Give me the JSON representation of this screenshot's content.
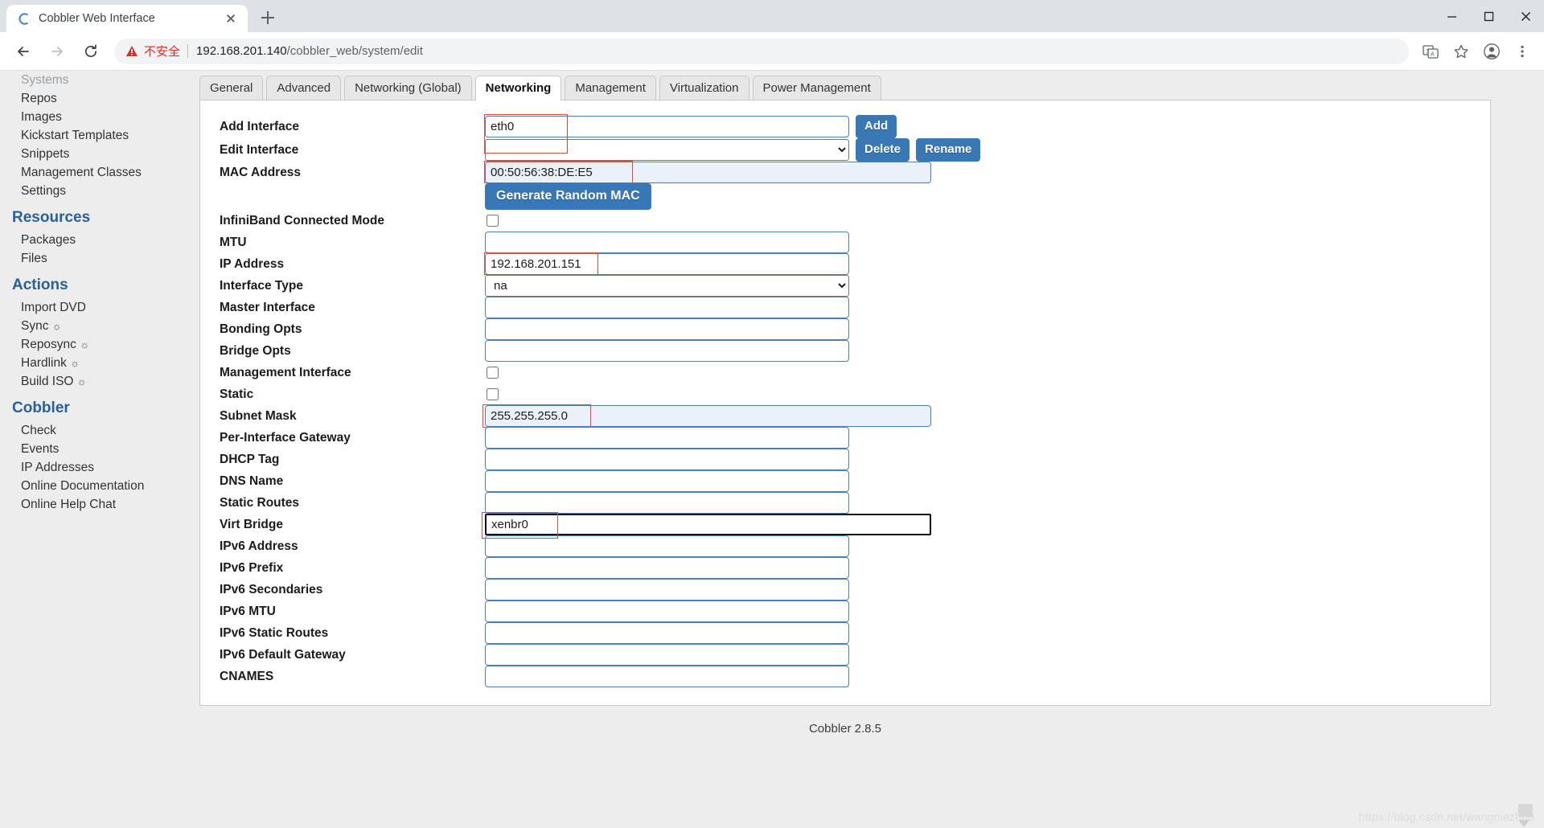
{
  "browser": {
    "tab": {
      "title": "Cobbler Web Interface",
      "favicon": "cobbler-c-logo"
    },
    "newtab_label": "+",
    "window_controls": [
      "minimize",
      "maximize",
      "close"
    ],
    "nav": {
      "back": "back-arrow",
      "forward": "forward-arrow",
      "reload": "reload"
    },
    "omnibox": {
      "warning_label": "不安全",
      "url_host": "192.168.201.140",
      "url_path": "/cobbler_web/system/edit"
    },
    "toolbar_icons": [
      "translate-icon",
      "bookmark-star-icon",
      "profile-avatar-icon",
      "menu-kebab-icon"
    ]
  },
  "sidebar": {
    "top_items": [
      {
        "label": "Systems",
        "clipped": true
      },
      {
        "label": "Repos"
      },
      {
        "label": "Images"
      },
      {
        "label": "Kickstart Templates"
      },
      {
        "label": "Snippets"
      },
      {
        "label": "Management Classes"
      },
      {
        "label": "Settings"
      }
    ],
    "sections": [
      {
        "heading": "Resources",
        "items": [
          {
            "label": "Packages"
          },
          {
            "label": "Files"
          }
        ]
      },
      {
        "heading": "Actions",
        "items": [
          {
            "label": "Import DVD"
          },
          {
            "label": "Sync",
            "gear": true
          },
          {
            "label": "Reposync",
            "gear": true
          },
          {
            "label": "Hardlink",
            "gear": true
          },
          {
            "label": "Build ISO",
            "gear": true
          }
        ]
      },
      {
        "heading": "Cobbler",
        "items": [
          {
            "label": "Check"
          },
          {
            "label": "Events"
          },
          {
            "label": "IP Addresses"
          },
          {
            "label": "Online Documentation"
          },
          {
            "label": "Online Help Chat"
          }
        ]
      }
    ]
  },
  "tabs": [
    {
      "label": "General",
      "active": false
    },
    {
      "label": "Advanced",
      "active": false
    },
    {
      "label": "Networking (Global)",
      "active": false
    },
    {
      "label": "Networking",
      "active": true
    },
    {
      "label": "Management",
      "active": false
    },
    {
      "label": "Virtualization",
      "active": false
    },
    {
      "label": "Power Management",
      "active": false
    }
  ],
  "form": {
    "rows": [
      {
        "label": "Add Interface",
        "type": "text",
        "value": "eth0",
        "highlight": false,
        "buttons": [
          "Add"
        ]
      },
      {
        "label": "Edit Interface",
        "type": "select",
        "value": "",
        "options": [
          ""
        ],
        "buttons": [
          "Delete",
          "Rename"
        ]
      },
      {
        "label": "MAC Address",
        "type": "text",
        "value": "00:50:56:38:DE:E5",
        "highlight": true
      },
      {
        "label": "",
        "type": "button",
        "value": "Generate Random MAC"
      },
      {
        "label": "InfiniBand Connected Mode",
        "type": "checkbox",
        "value": false
      },
      {
        "label": "MTU",
        "type": "text",
        "value": ""
      },
      {
        "label": "IP Address",
        "type": "text",
        "value": "192.168.201.151"
      },
      {
        "label": "Interface Type",
        "type": "select",
        "value": "na",
        "options": [
          "na"
        ]
      },
      {
        "label": "Master Interface",
        "type": "text",
        "value": ""
      },
      {
        "label": "Bonding Opts",
        "type": "text",
        "value": ""
      },
      {
        "label": "Bridge Opts",
        "type": "text",
        "value": ""
      },
      {
        "label": "Management Interface",
        "type": "checkbox",
        "value": false
      },
      {
        "label": "Static",
        "type": "checkbox",
        "value": false
      },
      {
        "label": "Subnet Mask",
        "type": "text",
        "value": "255.255.255.0",
        "highlight": true
      },
      {
        "label": "Per-Interface Gateway",
        "type": "text",
        "value": ""
      },
      {
        "label": "DHCP Tag",
        "type": "text",
        "value": ""
      },
      {
        "label": "DNS Name",
        "type": "text",
        "value": ""
      },
      {
        "label": "Static Routes",
        "type": "text",
        "value": ""
      },
      {
        "label": "Virt Bridge",
        "type": "text",
        "value": "xenbr0",
        "focused": true
      },
      {
        "label": "IPv6 Address",
        "type": "text",
        "value": ""
      },
      {
        "label": "IPv6 Prefix",
        "type": "text",
        "value": ""
      },
      {
        "label": "IPv6 Secondaries",
        "type": "text",
        "value": ""
      },
      {
        "label": "IPv6 MTU",
        "type": "text",
        "value": ""
      },
      {
        "label": "IPv6 Static Routes",
        "type": "text",
        "value": ""
      },
      {
        "label": "IPv6 Default Gateway",
        "type": "text",
        "value": ""
      },
      {
        "label": "CNAMES",
        "type": "text",
        "value": ""
      }
    ]
  },
  "footer": {
    "text": "Cobbler 2.8.5"
  },
  "watermark": {
    "text": "https://blog.csdn.net/wangniezhou"
  },
  "colors": {
    "accent_blue": "#3778b5",
    "heading_blue": "#2a6099",
    "input_border": "#4a7ebb",
    "annotation_red": "#e8453c",
    "filled_bg": "#eaf1fb",
    "warning_red": "#d93025"
  }
}
